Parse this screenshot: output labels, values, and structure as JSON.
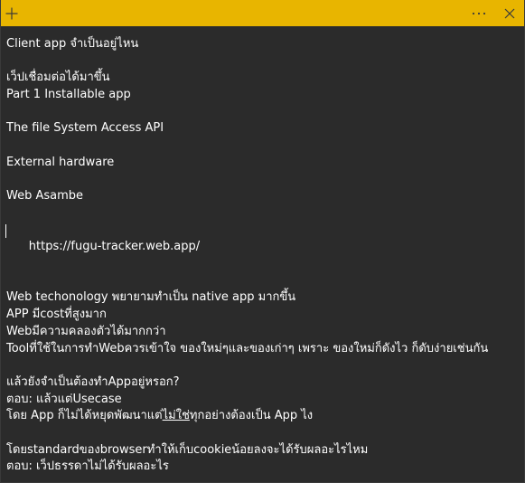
{
  "note": {
    "lines": [
      "Client app จำเป็นอยู่ไหน",
      "",
      "เว็ปเชื่อมต่อได้มาขึ้น",
      "Part 1 Installable app",
      "",
      "The file System Access API",
      "",
      "External hardware",
      "",
      "Web Asambe",
      "",
      "https://fugu-tracker.web.app/",
      "",
      "Web techonology พยายามทำเป็น native app มากขึ้น",
      "APP มีcostที่สูงมาก",
      "Webมีความคลองตัวได้มากกว่า",
      "Toolที่ใช้ในการทำWebควรเข้าใจ ของใหม่ๆและของเก่าๆ เพราะ ของใหม่ก็ดังไว ก็ดับง่ายเช่นกัน",
      "",
      "แล้วยังจำเป็นต้องทำAppอยู่หรอก?",
      "ตอบ: แล้วแต่Usecase",
      "",
      "",
      "โดยstandardของbrowserทำให้เก็บcookieน้อยลงจะได้รับผลอะไรไหม",
      "ตอบ: เว็ปธรรดาไม่ได้รับผลอะไร"
    ],
    "line21": {
      "before": "โดย App ก็ไม่ได้หยุดพัฒนาแต่",
      "underlined": "ไม่ใช่",
      "after": "ทุกอย่างต้องเป็น App ไง"
    }
  },
  "titlebar": {
    "add_icon": "plus-icon",
    "menu_icon": "ellipsis-icon",
    "close_icon": "close-icon"
  }
}
